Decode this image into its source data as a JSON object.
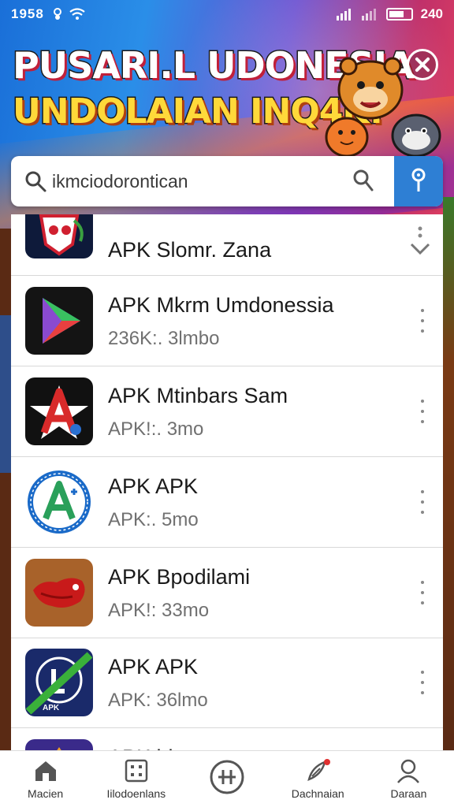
{
  "status_bar": {
    "time": "1958",
    "right_text": "240"
  },
  "banner": {
    "headline_line1": "PUSARI.L UDONESIA",
    "headline_line2": "UNDOLAIAN INQ4K!"
  },
  "search": {
    "value": "ikmciodorontican"
  },
  "apps": [
    {
      "title": "APK Slomr. Zana",
      "meta": ""
    },
    {
      "title": "APK Mkrm Umdonessia",
      "meta": "236K:. 3lmbo"
    },
    {
      "title": "APK Mtinbars Sam",
      "meta": "APK!:. 3mo"
    },
    {
      "title": "APK APK",
      "meta": "APK:. 5mo"
    },
    {
      "title": "APK Bpodilami",
      "meta": "APK!: 33mo"
    },
    {
      "title": "APK APK",
      "meta": "APK: 36lmo"
    },
    {
      "title": "APK ldon",
      "meta": ""
    }
  ],
  "nav": [
    {
      "label": "Macien",
      "icon": "home-icon"
    },
    {
      "label": "Iilodoenlans",
      "icon": "grid-icon"
    },
    {
      "label": "",
      "icon": "add-circle-icon"
    },
    {
      "label": "Dachnaian",
      "icon": "rocket-icon"
    },
    {
      "label": "Daraan",
      "icon": "profile-icon"
    }
  ],
  "colors": {
    "accent": "#2e7fd4",
    "headline_yellow": "#ffd93a"
  }
}
